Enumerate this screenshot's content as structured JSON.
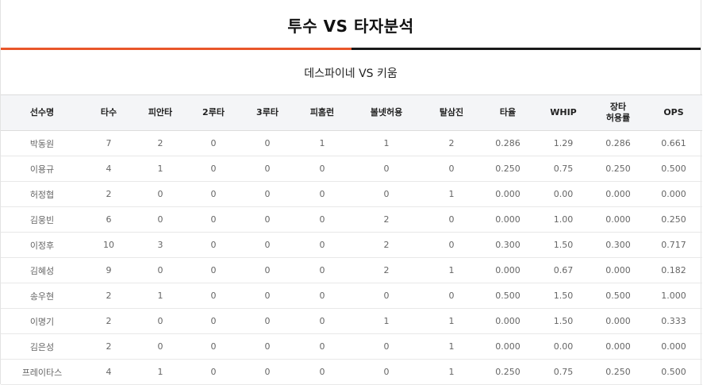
{
  "page": {
    "title": "투수 VS 타자분석",
    "subtitle": "데스파이네 VS 키움"
  },
  "table": {
    "headers": [
      "선수명",
      "타수",
      "피안타",
      "2루타",
      "3루타",
      "피홈런",
      "볼넷허용",
      "탈삼진",
      "타율",
      "WHIP",
      "장타\n허용률",
      "OPS"
    ],
    "rows": [
      [
        "박동원",
        "7",
        "2",
        "0",
        "0",
        "1",
        "1",
        "2",
        "0.286",
        "1.29",
        "0.286",
        "0.661"
      ],
      [
        "이용규",
        "4",
        "1",
        "0",
        "0",
        "0",
        "0",
        "0",
        "0.250",
        "0.75",
        "0.250",
        "0.500"
      ],
      [
        "허정협",
        "2",
        "0",
        "0",
        "0",
        "0",
        "0",
        "1",
        "0.000",
        "0.00",
        "0.000",
        "0.000"
      ],
      [
        "김웅빈",
        "6",
        "0",
        "0",
        "0",
        "0",
        "2",
        "0",
        "0.000",
        "1.00",
        "0.000",
        "0.250"
      ],
      [
        "이정후",
        "10",
        "3",
        "0",
        "0",
        "0",
        "2",
        "0",
        "0.300",
        "1.50",
        "0.300",
        "0.717"
      ],
      [
        "김혜성",
        "9",
        "0",
        "0",
        "0",
        "0",
        "2",
        "1",
        "0.000",
        "0.67",
        "0.000",
        "0.182"
      ],
      [
        "송우현",
        "2",
        "1",
        "0",
        "0",
        "0",
        "0",
        "0",
        "0.500",
        "1.50",
        "0.500",
        "1.000"
      ],
      [
        "이명기",
        "2",
        "0",
        "0",
        "0",
        "0",
        "1",
        "1",
        "0.000",
        "1.50",
        "0.000",
        "0.333"
      ],
      [
        "김은성",
        "2",
        "0",
        "0",
        "0",
        "0",
        "0",
        "1",
        "0.000",
        "0.00",
        "0.000",
        "0.000"
      ],
      [
        "프레이타스",
        "4",
        "1",
        "0",
        "0",
        "0",
        "0",
        "1",
        "0.250",
        "0.75",
        "0.250",
        "0.500"
      ]
    ]
  }
}
